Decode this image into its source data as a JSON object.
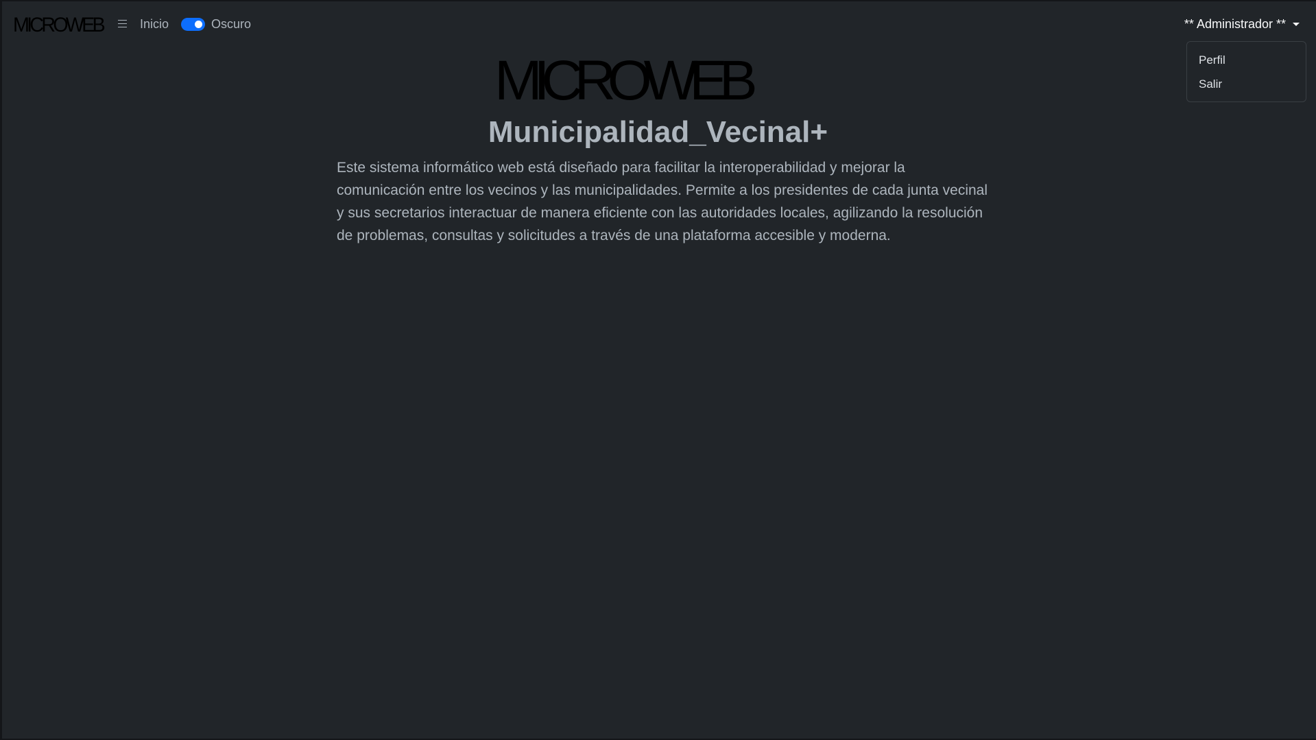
{
  "navbar": {
    "brand": "MICROWEB",
    "menu_icon": "hamburger-icon",
    "home_link": "Inicio",
    "theme_toggle": {
      "label": "Oscuro",
      "checked": true
    },
    "user_menu": {
      "label": "** Administrador **",
      "items": [
        "Perfil",
        "Salir"
      ]
    }
  },
  "main": {
    "logo": "MICROWEB",
    "title": "Municipalidad_Vecinal+",
    "description": "Este sistema informático web está diseñado para facilitar la interoperabilidad y mejorar la comunicación entre los vecinos y las municipalidades. Permite a los presidentes de cada junta vecinal y sus secretarios interactuar de manera eficiente con las autoridades locales, agilizando la resolución de problemas, consultas y solicitudes a través de una plataforma accesible y moderna."
  },
  "colors": {
    "background": "#212529",
    "accent": "#0d6efd",
    "text_muted": "#adb5bd",
    "text_light": "#f8f9fa"
  }
}
